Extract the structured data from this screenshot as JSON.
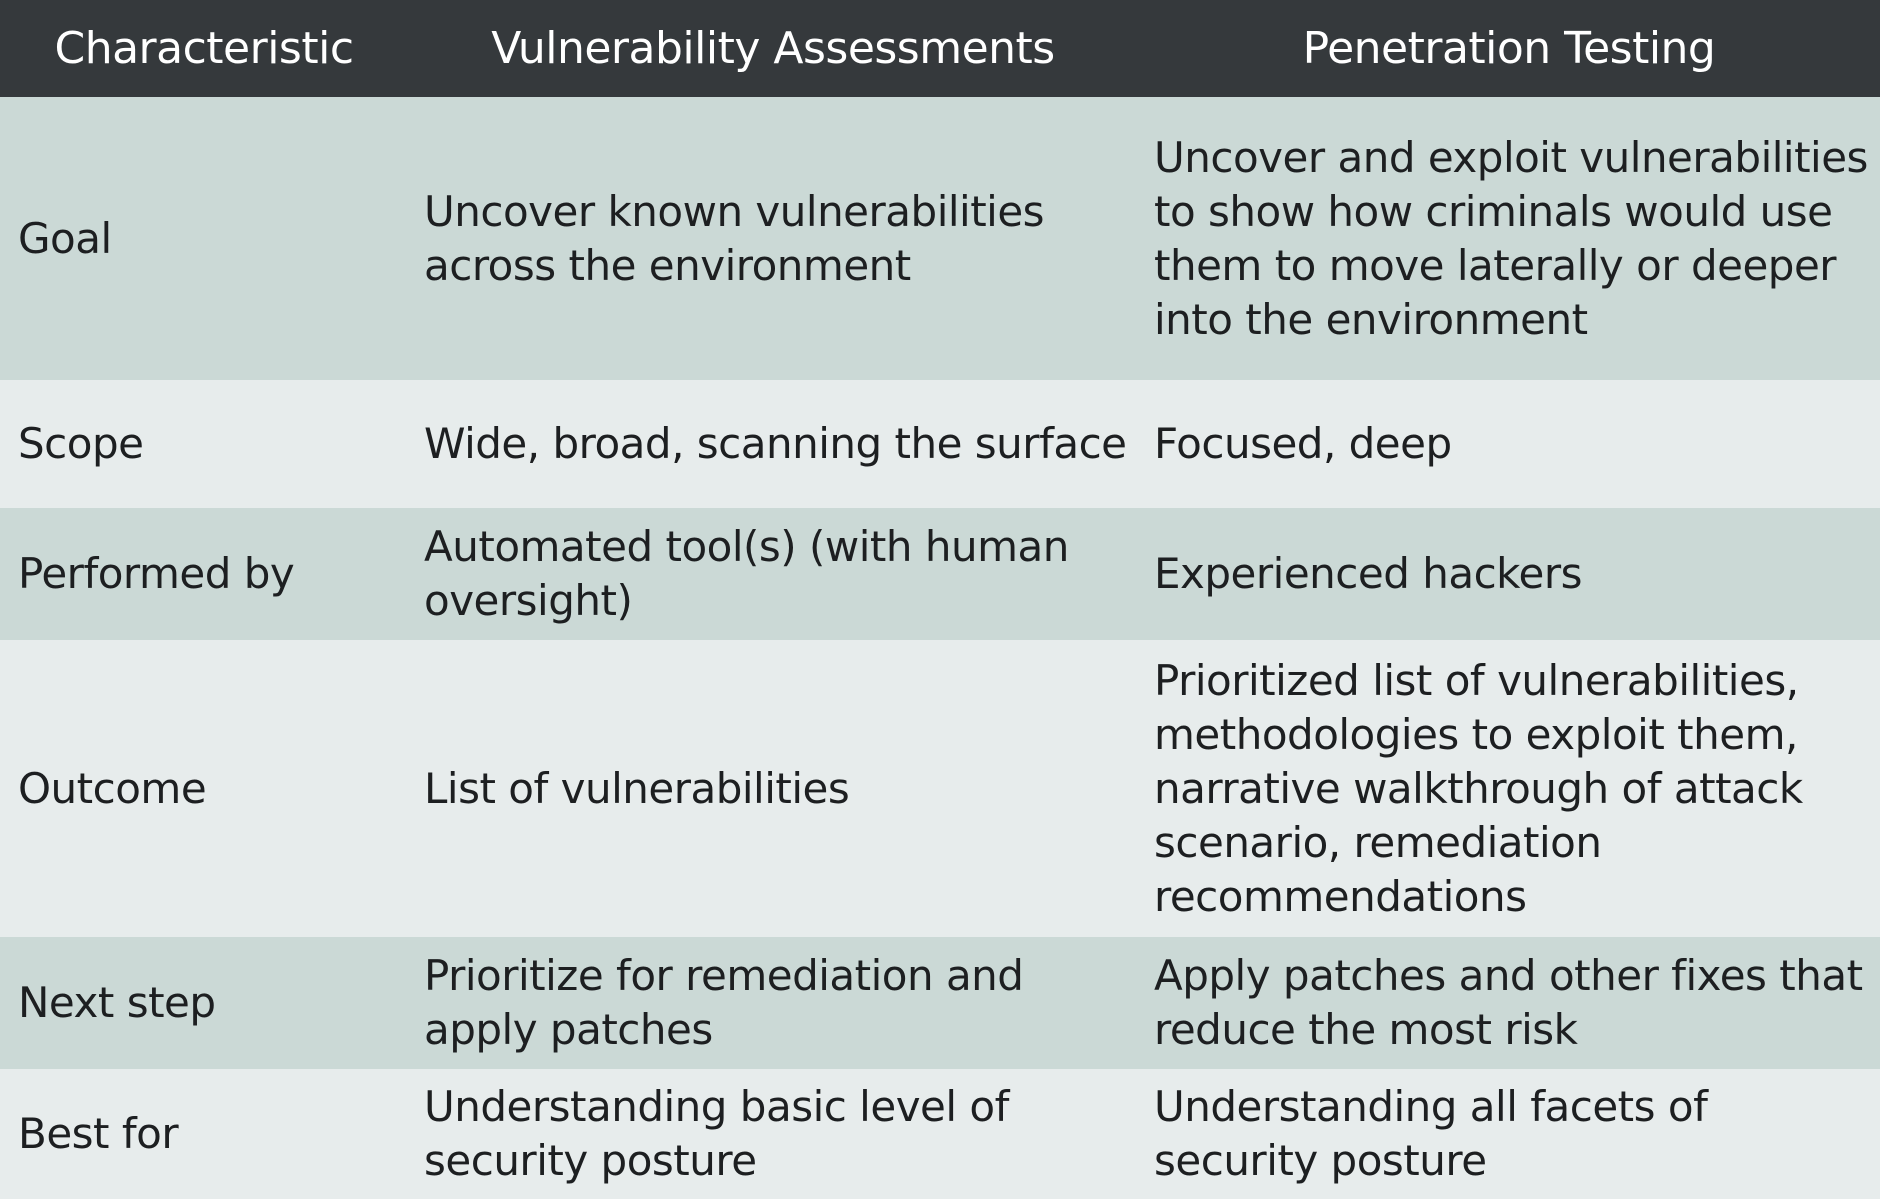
{
  "header": {
    "characteristic": "Characteristic",
    "vulnerability_assessments": "Vulnerability Assessments",
    "penetration_testing": "Penetration Testing"
  },
  "rows": [
    {
      "characteristic": "Goal",
      "vulnerability_assessments": "Uncover known vulnerabilities across the environment",
      "penetration_testing": "Uncover and exploit vulnerabilities to show how criminals would use them to move laterally or deeper into the environment"
    },
    {
      "characteristic": "Scope",
      "vulnerability_assessments": "Wide, broad, scanning the surface",
      "penetration_testing": "Focused, deep"
    },
    {
      "characteristic": "Performed by",
      "vulnerability_assessments": "Automated tool(s) (with human oversight)",
      "penetration_testing": "Experienced hackers"
    },
    {
      "characteristic": "Outcome",
      "vulnerability_assessments": "List of vulnerabilities",
      "penetration_testing": "Prioritized list of vulnerabilities, methodologies to exploit them, narrative walkthrough of attack scenario, remediation recommendations"
    },
    {
      "characteristic": "Next step",
      "vulnerability_assessments": "Prioritize for remediation and apply patches",
      "penetration_testing": "Apply patches and other fixes that reduce the most risk"
    },
    {
      "characteristic": "Best for",
      "vulnerability_assessments": "Understanding basic level of security posture",
      "penetration_testing": "Understanding all facets of security posture"
    }
  ],
  "colors": {
    "header_bg": "#35393c",
    "header_text": "#ffffff",
    "row_dark": "#cbd9d6",
    "row_light": "#e7ecec",
    "body_text": "#1d1f21"
  }
}
